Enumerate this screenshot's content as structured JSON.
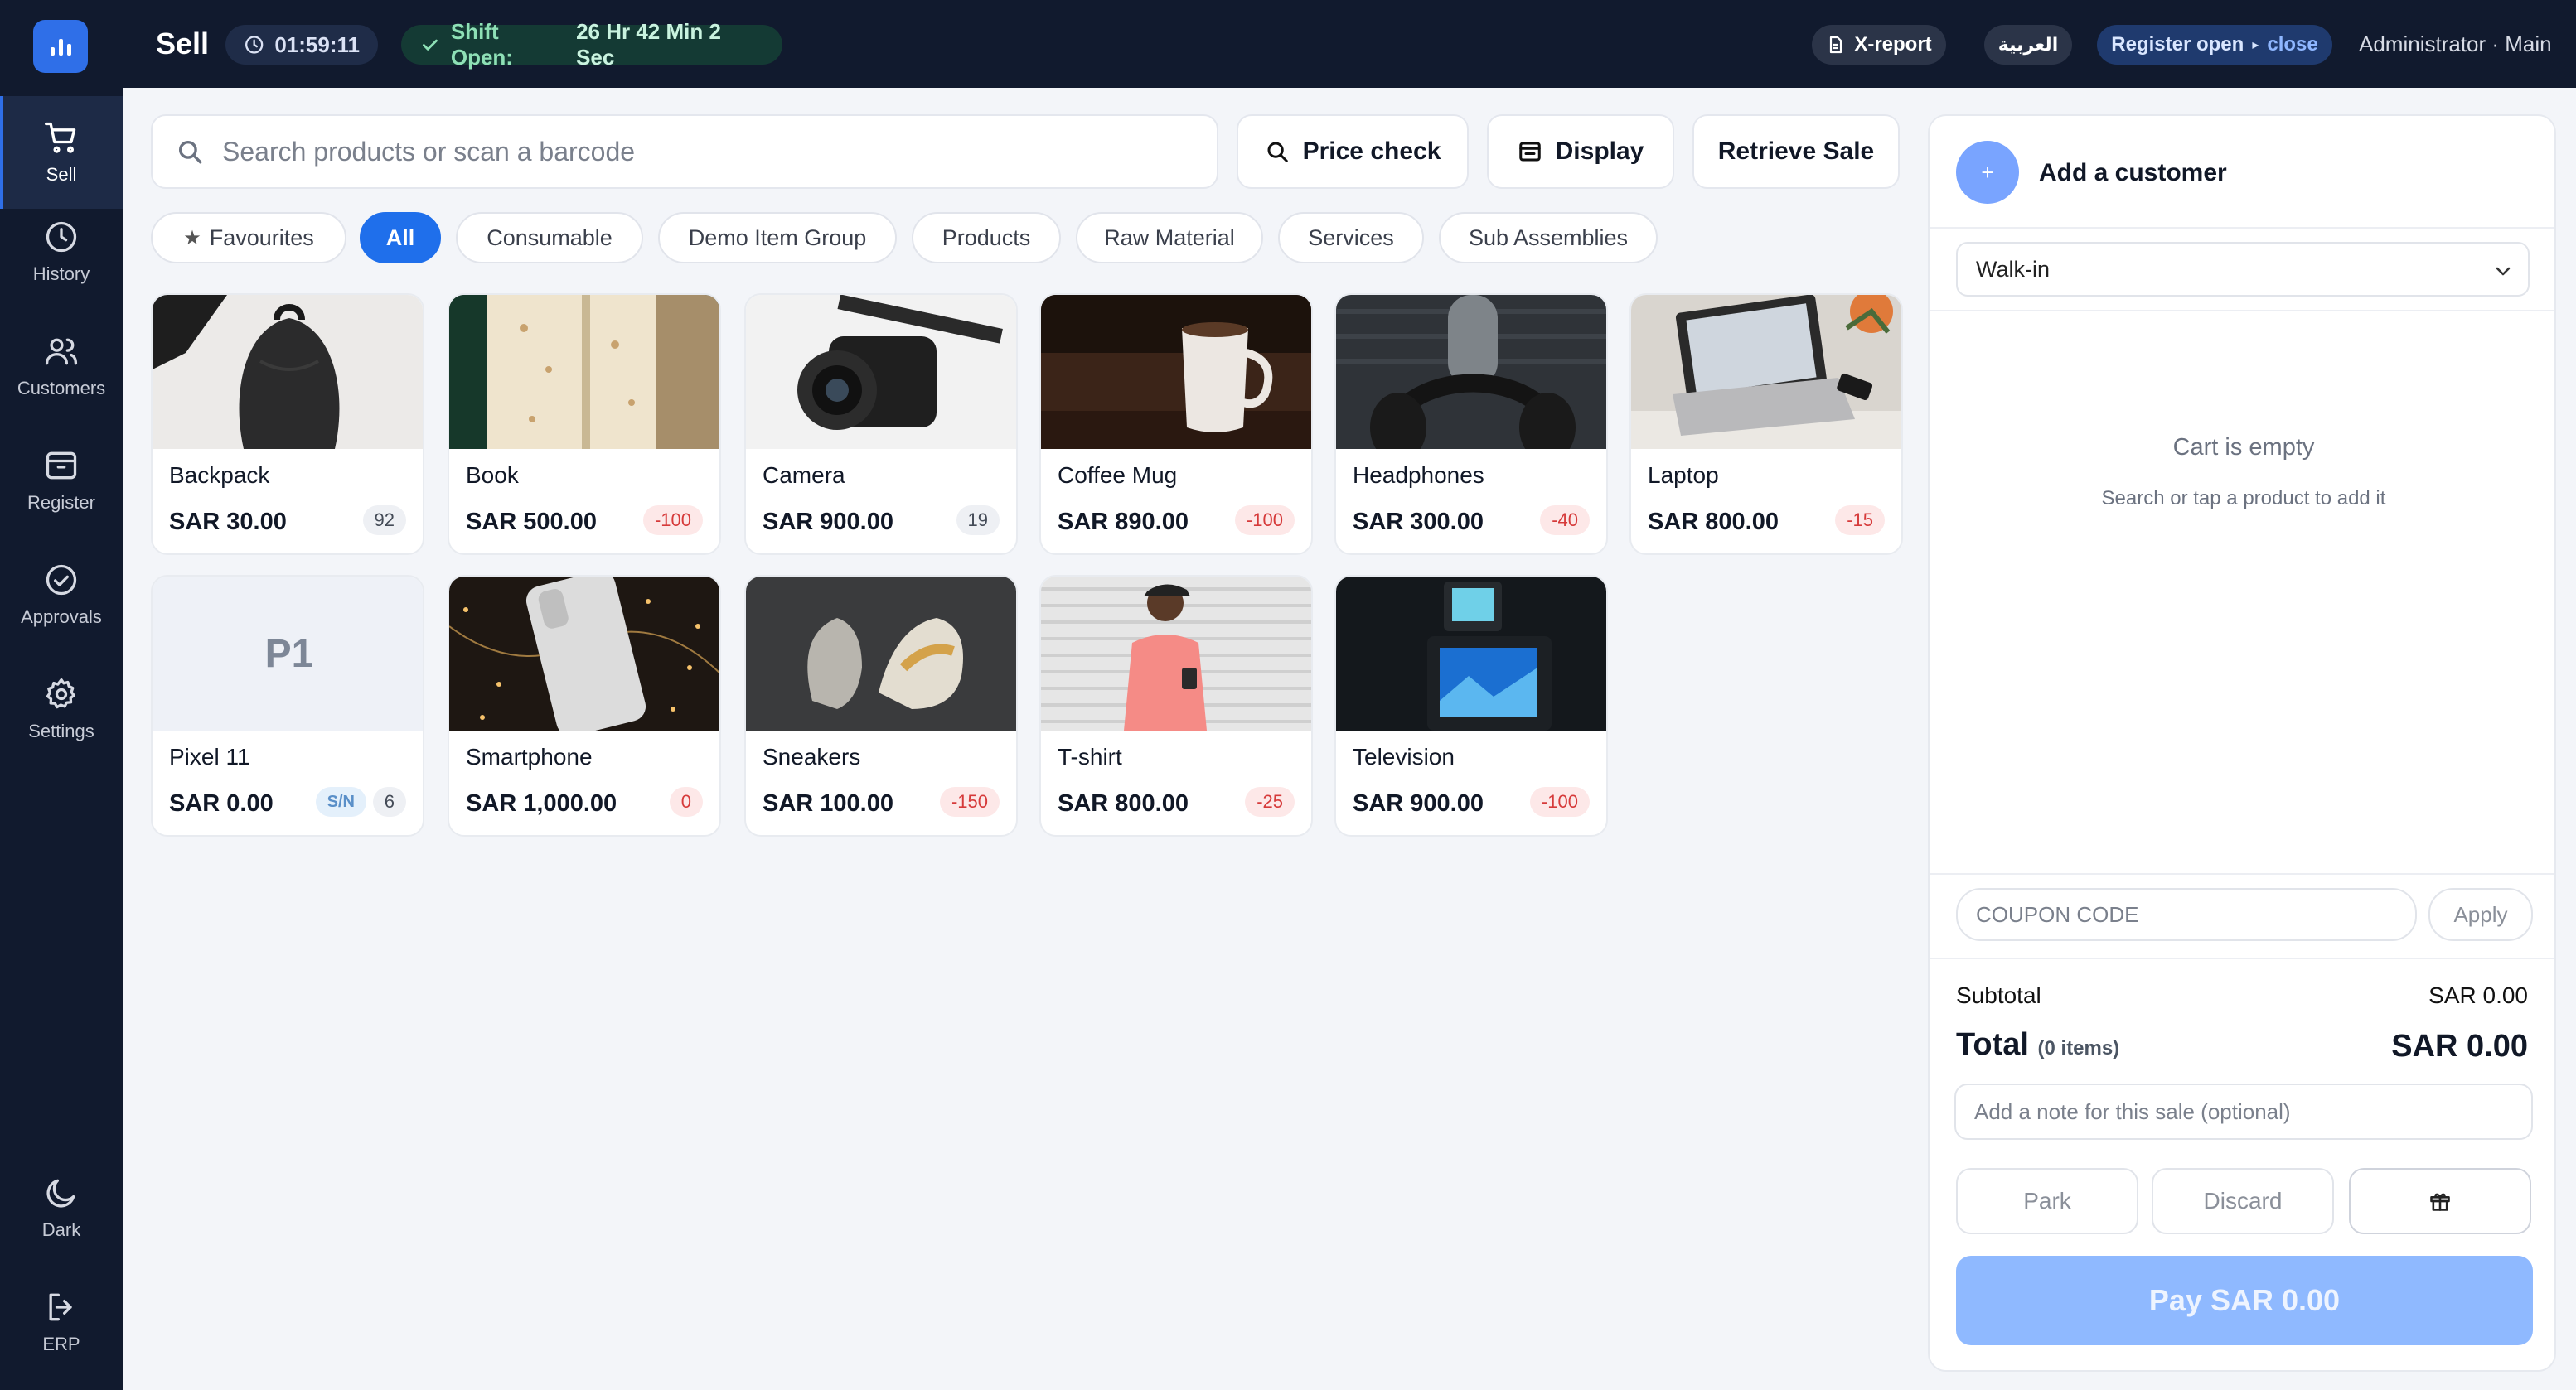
{
  "topbar": {
    "title": "Sell",
    "timer": "01:59:11",
    "shift_label": "Shift Open:",
    "shift_duration": "26 Hr 42 Min 2 Sec",
    "xreport": "X-report",
    "language": "العربية",
    "register_status": "Register open",
    "register_sep": "▸",
    "register_action": "close",
    "user": "Administrator · Main"
  },
  "sidebar": {
    "items": [
      {
        "label": "Sell",
        "icon": "cart-icon",
        "active": true
      },
      {
        "label": "History",
        "icon": "clock-icon"
      },
      {
        "label": "Customers",
        "icon": "users-icon"
      },
      {
        "label": "Register",
        "icon": "register-icon"
      },
      {
        "label": "Approvals",
        "icon": "check-circle-icon"
      },
      {
        "label": "Settings",
        "icon": "gear-icon"
      }
    ],
    "bottom": [
      {
        "label": "Dark",
        "icon": "moon-icon"
      },
      {
        "label": "ERP",
        "icon": "logout-icon"
      }
    ]
  },
  "search": {
    "placeholder": "Search products or scan a barcode"
  },
  "actions": {
    "price_check": "Price check",
    "display": "Display",
    "retrieve_sale": "Retrieve Sale"
  },
  "categories": [
    {
      "label": "Favourites",
      "icon": "star-icon"
    },
    {
      "label": "All",
      "active": true
    },
    {
      "label": "Consumable"
    },
    {
      "label": "Demo Item Group"
    },
    {
      "label": "Products"
    },
    {
      "label": "Raw Material"
    },
    {
      "label": "Services"
    },
    {
      "label": "Sub Assemblies"
    }
  ],
  "products": [
    {
      "name": "Backpack",
      "price": "SAR 30.00",
      "stock": "92",
      "stock_type": "neutral"
    },
    {
      "name": "Book",
      "price": "SAR 500.00",
      "stock": "-100",
      "stock_type": "neg"
    },
    {
      "name": "Camera",
      "price": "SAR 900.00",
      "stock": "19",
      "stock_type": "neutral"
    },
    {
      "name": "Coffee Mug",
      "price": "SAR 890.00",
      "stock": "-100",
      "stock_type": "neg"
    },
    {
      "name": "Headphones",
      "price": "SAR 300.00",
      "stock": "-40",
      "stock_type": "neg"
    },
    {
      "name": "Laptop",
      "price": "SAR 800.00",
      "stock": "-15",
      "stock_type": "neg"
    },
    {
      "name": "Pixel 11",
      "price": "SAR 0.00",
      "placeholder_text": "P1",
      "serial": "S/N",
      "stock": "6",
      "stock_type": "neutral"
    },
    {
      "name": "Smartphone",
      "price": "SAR 1,000.00",
      "stock": "0",
      "stock_type": "neg"
    },
    {
      "name": "Sneakers",
      "price": "SAR 100.00",
      "stock": "-150",
      "stock_type": "neg"
    },
    {
      "name": "T-shirt",
      "price": "SAR 800.00",
      "stock": "-25",
      "stock_type": "neg"
    },
    {
      "name": "Television",
      "price": "SAR 900.00",
      "stock": "-100",
      "stock_type": "neg"
    }
  ],
  "cart": {
    "add_customer": "Add a customer",
    "add_customer_icon": "+",
    "customer": "Walk-in",
    "empty_title": "Cart is empty",
    "empty_hint": "Search or tap a product to add it",
    "coupon_placeholder": "COUPON CODE",
    "apply": "Apply",
    "subtotal_label": "Subtotal",
    "subtotal_value": "SAR 0.00",
    "total_label": "Total",
    "total_items": "(0 items)",
    "total_value": "SAR 0.00",
    "note_placeholder": "Add a note for this sale (optional)",
    "park": "Park",
    "discard": "Discard",
    "pay": "Pay SAR 0.00"
  },
  "colors": {
    "sidebar_bg": "#111a2e",
    "accent": "#1f6feb",
    "pay_button": "#8fb9ff",
    "negative_stock": "#d63a3a"
  }
}
